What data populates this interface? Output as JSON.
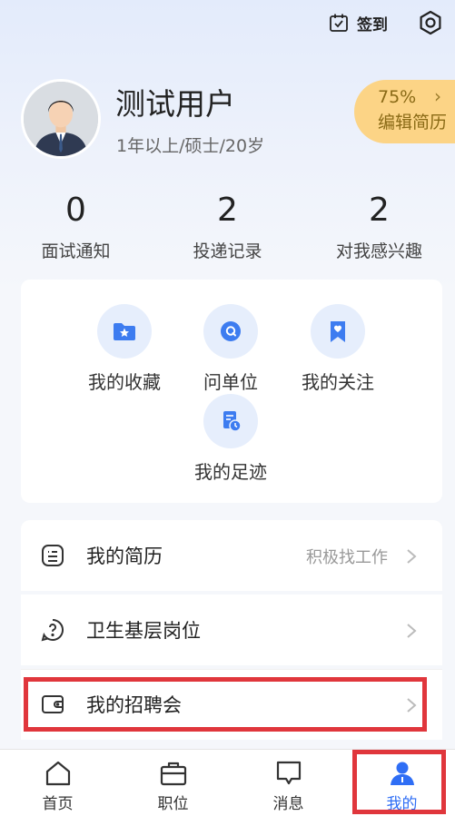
{
  "topbar": {
    "checkin_label": "签到",
    "checkin_icon": "calendar-check-icon",
    "settings_icon": "gear-icon"
  },
  "profile": {
    "name": "测试用户",
    "subtitle": "1年以上/硕士/20岁",
    "resume_percent": "75%",
    "resume_label": "编辑简历"
  },
  "stats": [
    {
      "value": "0",
      "label": "面试通知"
    },
    {
      "value": "2",
      "label": "投递记录"
    },
    {
      "value": "2",
      "label": "对我感兴趣"
    }
  ],
  "quick_links": [
    {
      "label": "我的收藏",
      "icon": "folder-star-icon"
    },
    {
      "label": "问单位",
      "icon": "chat-question-icon"
    },
    {
      "label": "我的关注",
      "icon": "bookmark-heart-icon"
    },
    {
      "label": "我的足迹",
      "icon": "history-document-icon"
    }
  ],
  "menu": [
    {
      "label": "我的简历",
      "right_text": "积极找工作",
      "icon": "resume-list-icon"
    },
    {
      "label": "卫生基层岗位",
      "right_text": "",
      "icon": "question-circle-icon"
    },
    {
      "label": "我的招聘会",
      "right_text": "",
      "icon": "wallet-icon"
    }
  ],
  "tabs": [
    {
      "label": "首页",
      "icon": "home-icon"
    },
    {
      "label": "职位",
      "icon": "briefcase-icon"
    },
    {
      "label": "消息",
      "icon": "message-icon"
    },
    {
      "label": "我的",
      "icon": "user-icon",
      "active": true
    }
  ],
  "colors": {
    "accent": "#2f6ef5",
    "highlight": "#e0363c",
    "pill": "#fcd486"
  }
}
